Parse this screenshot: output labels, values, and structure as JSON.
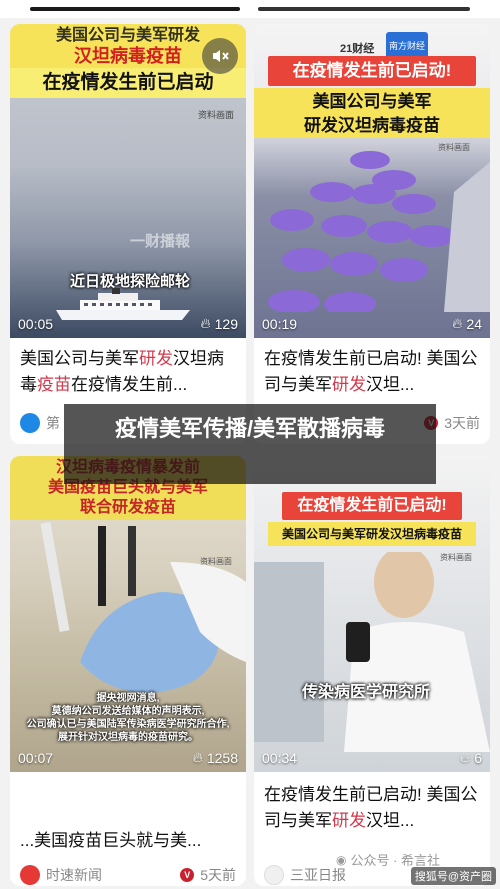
{
  "overlay": {
    "title": "疫情美军传播/美军散播病毒"
  },
  "watermark": "搜狐号@资产圈",
  "cards": [
    {
      "banner_top": "美国公司与美军研发",
      "banner_mid": "汉坦病毒疫苗",
      "banner_red": "在疫情发生前已启动",
      "source_tag": "资料画面",
      "ship_caption": "近日极地探险邮轮",
      "faint_caption": "一财播報",
      "duration": "00:05",
      "likes": "129",
      "title_parts": [
        "美国公司与美军",
        "研发",
        "汉坦病毒",
        "疫苗",
        "在疫情发生前..."
      ],
      "source_name": "第",
      "time": "",
      "mute_icon": "mute-icon"
    },
    {
      "logo_text": "21财经",
      "badge_text": "南方财经",
      "banner_red": "在疫情发生前已启动!",
      "banner_yellow_1": "美国公司与美军",
      "banner_yellow_2": "研发汉坦病毒疫苗",
      "source_tag": "资料画面",
      "duration": "00:19",
      "likes": "24",
      "title_parts": [
        "在疫情发生前已启动! 美国公司与美军",
        "研发",
        "汉坦..."
      ],
      "time": "3天前"
    },
    {
      "banner_top": "汉坦病毒疫情暴发前",
      "banner_mid": "美国疫苗巨头就与美军",
      "banner_bottom": "联合研发疫苗",
      "source_tag": "资料画面",
      "caption_1": "据央视网消息,",
      "caption_2": "莫德纳公司发送给媒体的声明表示,",
      "caption_3": "公司确认已与美国陆军传染病医学研究所合作,",
      "caption_4": "展开针对汉坦病毒的疫苗研究。",
      "duration": "00:07",
      "likes": "1258",
      "title": "...美国疫苗巨头就与美...",
      "source_name": "时速新闻",
      "time": "5天前"
    },
    {
      "banner_red": "在疫情发生前已启动!",
      "banner_yellow": "美国公司与美军研发汉坦病毒疫苗",
      "source_tag": "资料画面",
      "lab_caption": "传染病医学研究所",
      "duration": "00:34",
      "likes": "6",
      "title_parts": [
        "在疫情发生前已启动! 美国公司与美军",
        "研发",
        "汉坦..."
      ],
      "source_name": "三亚日报",
      "publisher_mark": "公众号 · 希言社"
    }
  ]
}
